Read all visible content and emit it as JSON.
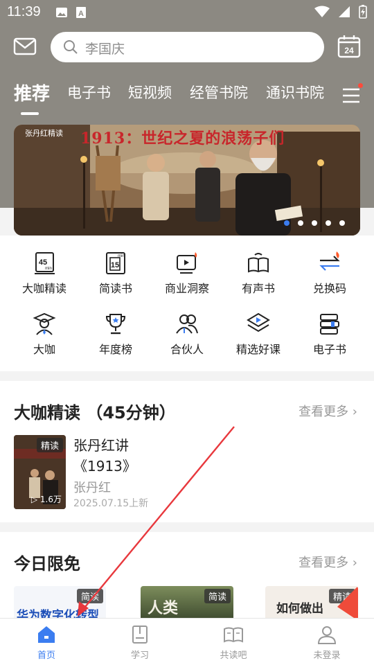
{
  "status_bar": {
    "time": "11:39"
  },
  "header": {
    "search_placeholder": "李国庆",
    "calendar_day": "24",
    "tabs": [
      {
        "label": "推荐",
        "active": true
      },
      {
        "label": "电子书"
      },
      {
        "label": "短视频"
      },
      {
        "label": "经管书院"
      },
      {
        "label": "通识书院"
      }
    ]
  },
  "banner": {
    "tag": "张丹红精读",
    "title": "1913：世纪之夏的浪荡子们",
    "total_slides": 5,
    "active_slide": 1
  },
  "grid": {
    "row1": [
      {
        "label": "大咖精读",
        "icon": "book-45min-icon"
      },
      {
        "label": "简读书",
        "icon": "book-15min-icon"
      },
      {
        "label": "商业洞察",
        "icon": "business-insight-icon"
      },
      {
        "label": "有声书",
        "icon": "audiobook-icon"
      },
      {
        "label": "兑换码",
        "icon": "exchange-icon"
      }
    ],
    "row2": [
      {
        "label": "大咖",
        "icon": "graduate-icon"
      },
      {
        "label": "年度榜",
        "icon": "trophy-icon"
      },
      {
        "label": "合伙人",
        "icon": "partners-icon"
      },
      {
        "label": "精选好课",
        "icon": "course-icon"
      },
      {
        "label": "电子书",
        "icon": "ebook-icon"
      }
    ],
    "icon_45_text": "45",
    "icon_15_text": "15",
    "icon_min_text": "min"
  },
  "section1": {
    "title": "大咖精读 （45分钟）",
    "more": "查看更多",
    "book": {
      "badge": "精读",
      "title_line1": "张丹红讲",
      "title_line2": "《1913》",
      "author": "张丹红",
      "date": "2025.07.15上新",
      "plays": "1.6万"
    }
  },
  "section2": {
    "title": "今日限免",
    "more": "查看更多",
    "cards": [
      {
        "badge": "简读",
        "text": "华为数字化转型"
      },
      {
        "badge": "简读",
        "text": "人类"
      },
      {
        "badge": "精读",
        "text": "如何做出"
      }
    ]
  },
  "bottom_nav": [
    {
      "label": "首页",
      "active": true
    },
    {
      "label": "学习"
    },
    {
      "label": "共读吧"
    },
    {
      "label": "未登录"
    }
  ],
  "colors": {
    "accent": "#3b7df0",
    "header_bg": "#8c8982",
    "banner_title": "#c8262b",
    "annotation": "#e8383d"
  }
}
